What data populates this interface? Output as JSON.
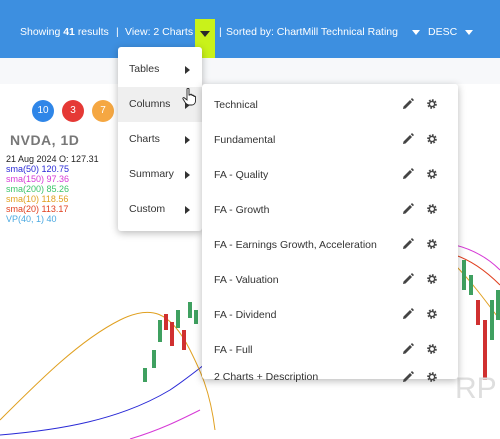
{
  "toolbar": {
    "showing_prefix": "Showing",
    "results_count": "41",
    "results_suffix": "results",
    "sep": "|",
    "view_label": "View: 2 Charts",
    "sorted_label": "Sorted by: ChartMill Technical Rating",
    "order_label": "DESC"
  },
  "badges": [
    {
      "value": "10",
      "color": "#2f86e8"
    },
    {
      "value": "3",
      "color": "#e53935"
    },
    {
      "value": "7",
      "color": "#f5a742"
    }
  ],
  "chart_header": {
    "ticker": "NVDA, 1D",
    "date_line": "21 Aug 2024   O: 127.31"
  },
  "legend": [
    {
      "text": "sma(50) 120.75",
      "color": "#2a2ad6"
    },
    {
      "text": "sma(150) 97.36",
      "color": "#d63ad6"
    },
    {
      "text": "sma(200) 85.26",
      "color": "#3cc46a"
    },
    {
      "text": "sma(10) 118.56",
      "color": "#e0a020"
    },
    {
      "text": "sma(20) 113.17",
      "color": "#e04020"
    },
    {
      "text": "VP(40, 1) 40",
      "color": "#4aa8e0"
    }
  ],
  "watermark": "RP",
  "main_menu": [
    {
      "label": "Tables",
      "has_submenu": true
    },
    {
      "label": "Columns",
      "has_submenu": true,
      "active": true
    },
    {
      "label": "Charts",
      "has_submenu": true
    },
    {
      "label": "Summary",
      "has_submenu": true
    },
    {
      "label": "Custom",
      "has_submenu": true
    }
  ],
  "columns_submenu": [
    {
      "label": "Technical",
      "edit_icon": "pencil-icon",
      "settings_icon": "gear-icon"
    },
    {
      "label": "Fundamental",
      "edit_icon": "pencil-icon",
      "settings_icon": "gear-icon"
    },
    {
      "label": "FA - Quality",
      "edit_icon": "pencil-icon",
      "settings_icon": "gear-icon"
    },
    {
      "label": "FA - Growth",
      "edit_icon": "pencil-icon",
      "settings_icon": "gear-icon"
    },
    {
      "label": "FA - Earnings Growth, Acceleration",
      "edit_icon": "pencil-icon",
      "settings_icon": "gear-icon"
    },
    {
      "label": "FA - Valuation",
      "edit_icon": "pencil-icon",
      "settings_icon": "gear-icon"
    },
    {
      "label": "FA - Dividend",
      "edit_icon": "pencil-icon",
      "settings_icon": "gear-icon"
    },
    {
      "label": "FA - Full",
      "edit_icon": "pencil-icon",
      "settings_icon": "gear-icon"
    },
    {
      "label": "2 Charts + Description",
      "edit_icon": "pencil-icon",
      "settings_icon": "gear-icon"
    }
  ],
  "colors": {
    "toolbar_bg": "#3d8fe0",
    "highlight": "#c9f21a",
    "candle_up": "#3fa060",
    "candle_down": "#d03030"
  }
}
